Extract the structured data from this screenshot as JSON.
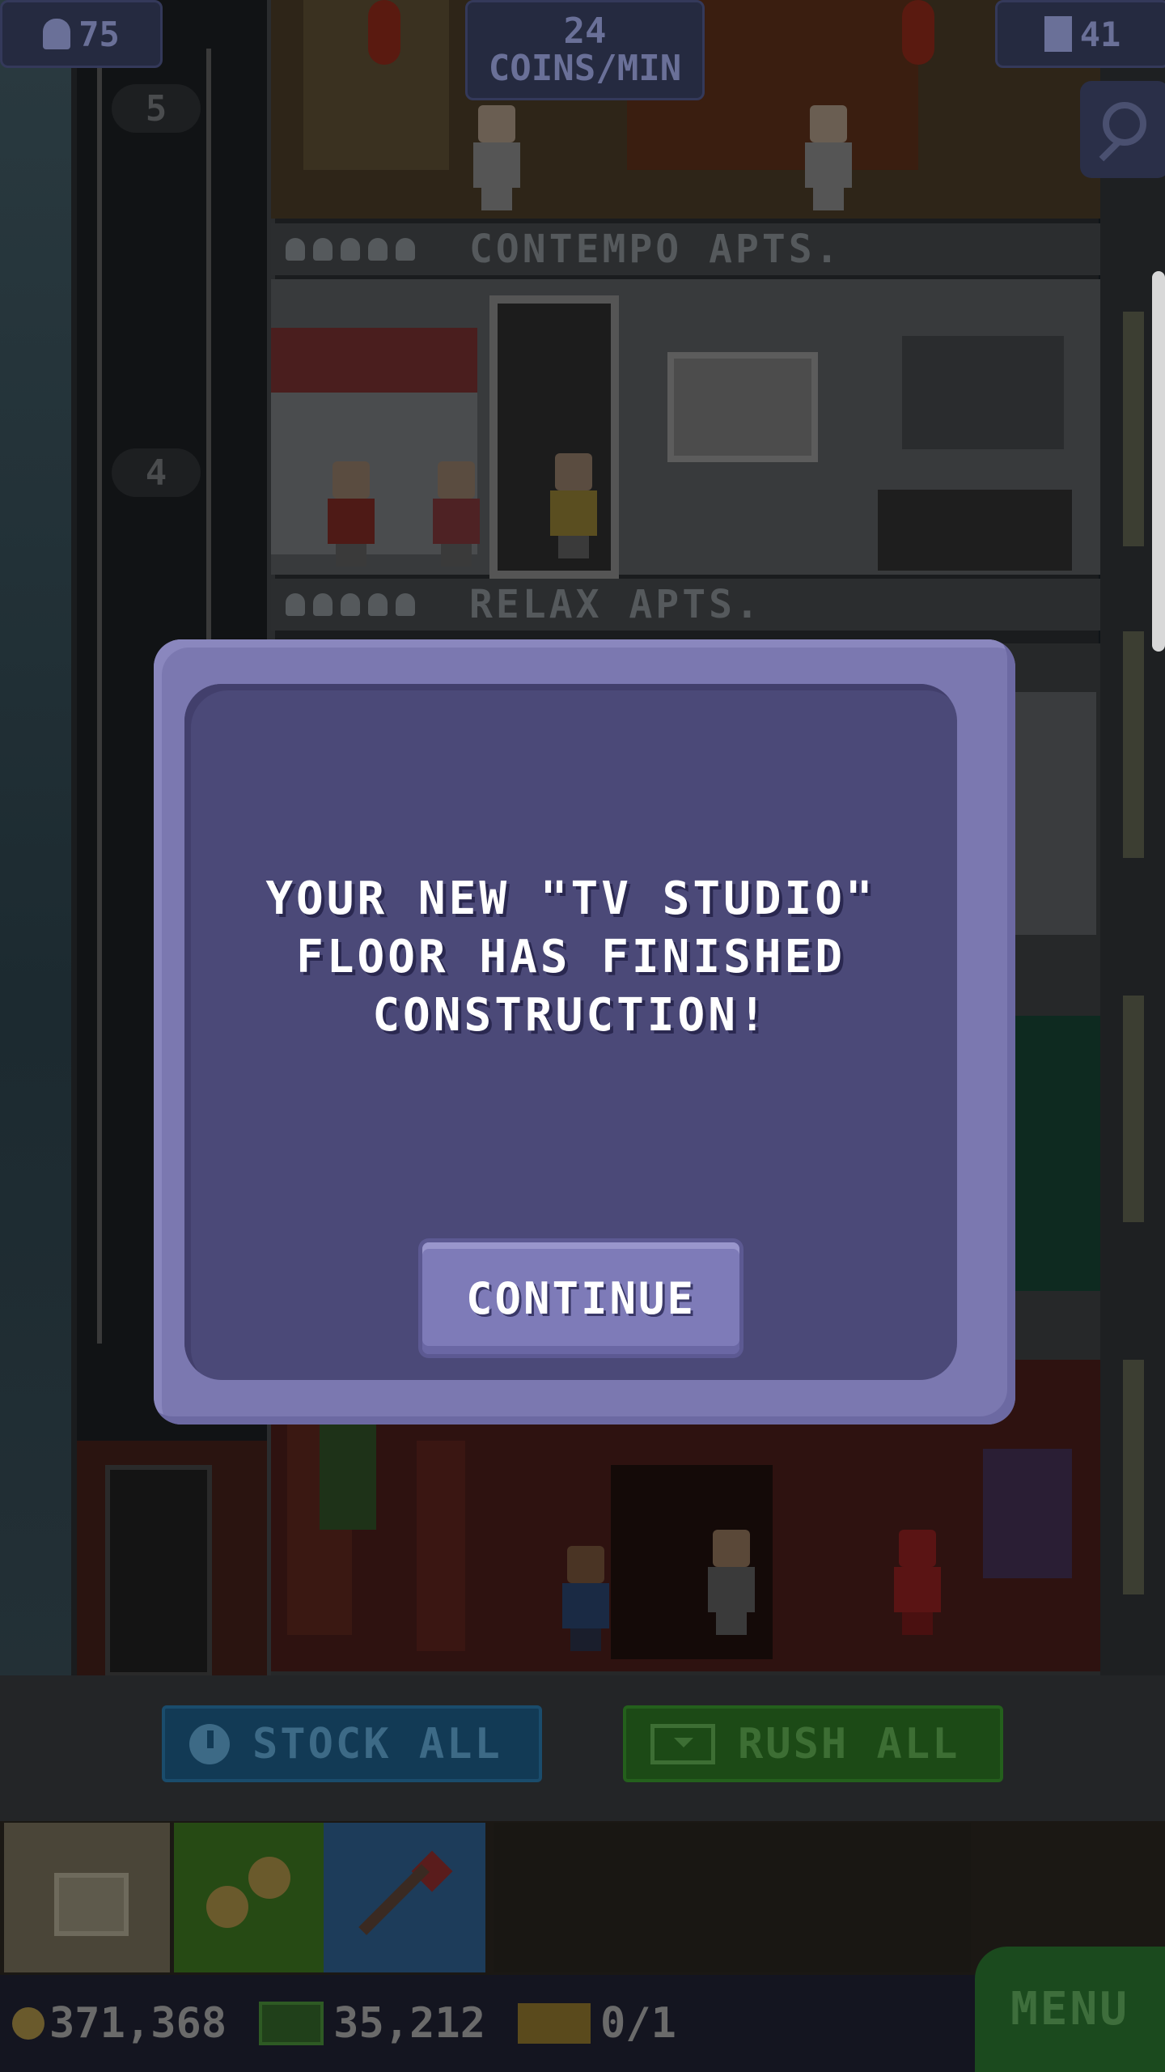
{
  "hud": {
    "population": "75",
    "coins_per_min_value": "24",
    "coins_per_min_label": "COINS/MIN",
    "floors": "41"
  },
  "floors": [
    {
      "number": "5",
      "name": "CONTEMPO APTS."
    },
    {
      "number": "4",
      "name": "RELAX APTS."
    }
  ],
  "modal": {
    "message_line1": "YOUR NEW \"TV STUDIO\"",
    "message_line2": "FLOOR HAS FINISHED",
    "message_line3": "CONSTRUCTION!",
    "button_label": "CONTINUE"
  },
  "actions": {
    "stock_all": "STOCK ALL",
    "rush_all": "RUSH ALL"
  },
  "status": {
    "coins": "371,368",
    "bux": "35,212",
    "tickets": "0/1"
  },
  "menu_label": "MENU",
  "colors": {
    "modal_outer": "#7b78b0",
    "modal_inner": "#4b4978",
    "stock_button": "#123a55",
    "rush_button": "#1c4a16",
    "menu_button": "#1b4a1e"
  },
  "icons": [
    "person-icon",
    "building-icon",
    "search-icon",
    "clock-icon",
    "cash-icon",
    "coin-icon",
    "bux-icon",
    "ticket-icon",
    "crate-icon",
    "coins-icon",
    "raffle-icon"
  ]
}
